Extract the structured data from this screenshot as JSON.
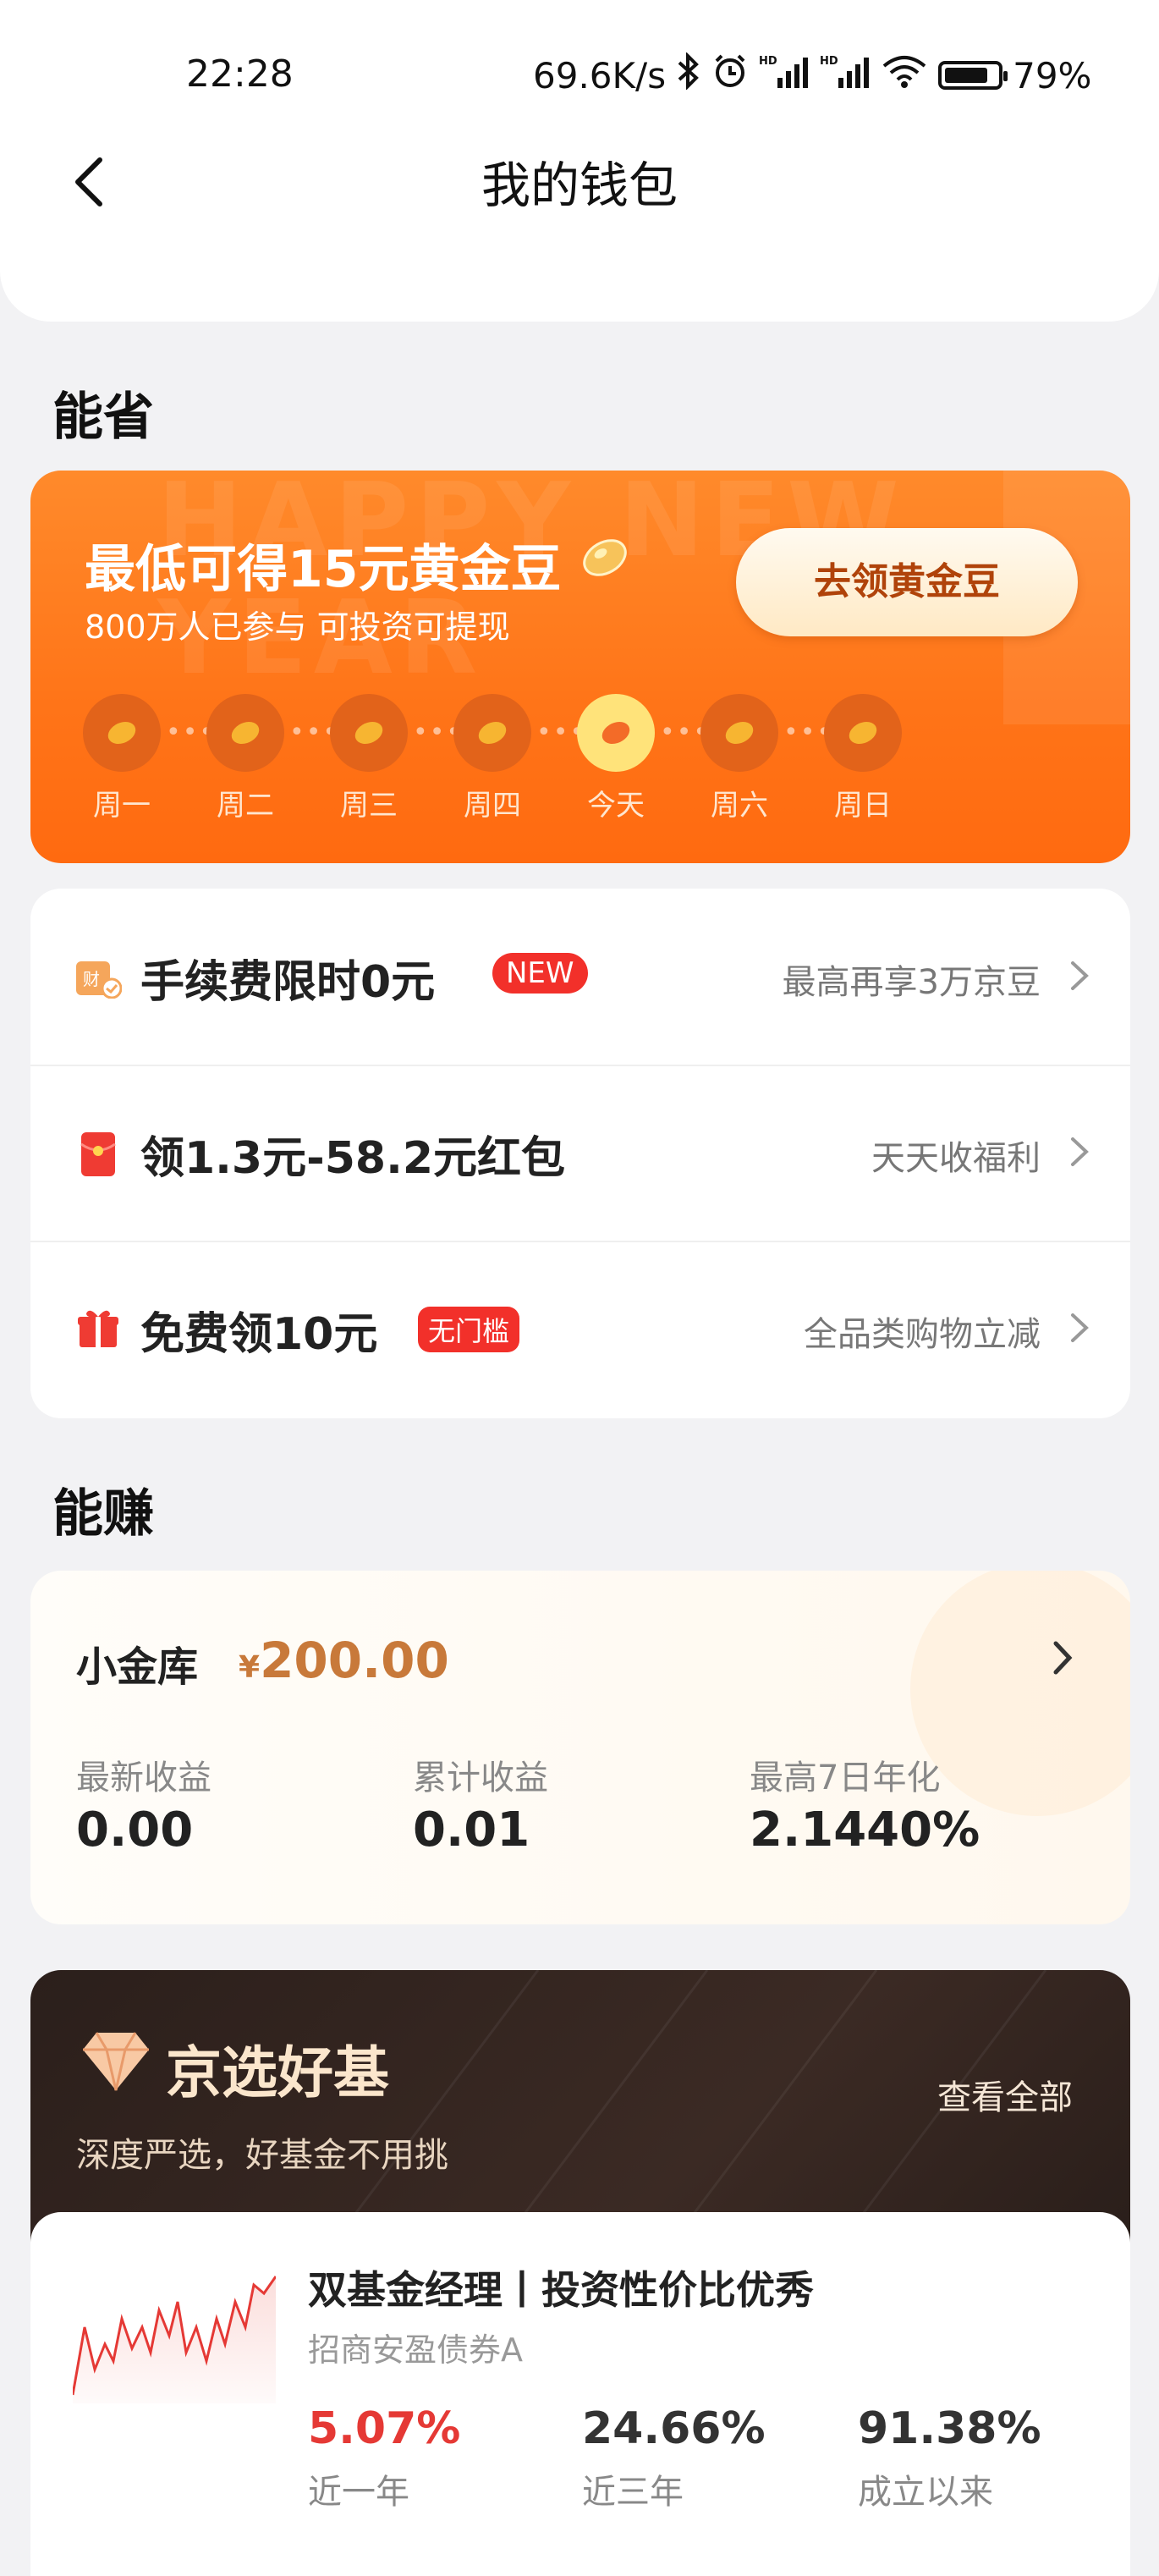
{
  "status_bar": {
    "time": "22:28",
    "network_speed": "69.6K/s",
    "battery": "79%"
  },
  "header": {
    "title": "我的钱包",
    "cut_off_items": [
      "",
      "",
      "",
      ""
    ]
  },
  "save_section": {
    "title": "能省",
    "gold_card": {
      "title": "最低可得15元黄金豆",
      "subtitle": "800万人已参与 可投资可提现",
      "button": "去领黄金豆",
      "days": [
        "周一",
        "周二",
        "周三",
        "周四",
        "今天",
        "周六",
        "周日"
      ]
    },
    "offers": [
      {
        "title": "手续费限时0元",
        "badge": "NEW",
        "right": "最高再享3万京豆",
        "icon": "fee-icon"
      },
      {
        "title": "领1.3元-58.2元红包",
        "badge": "",
        "right": "天天收福利",
        "icon": "red-packet-icon"
      },
      {
        "title": "免费领10元",
        "badge": "无门槛",
        "right": "全品类购物立减",
        "icon": "gift-icon"
      }
    ]
  },
  "earn_section": {
    "title": "能赚",
    "vault": {
      "title": "小金库",
      "currency": "¥",
      "amount": "200.00",
      "stats": [
        {
          "label": "最新收益",
          "value": "0.00"
        },
        {
          "label": "累计收益",
          "value": "0.01"
        },
        {
          "label": "最高7日年化",
          "value": "2.1440%"
        }
      ]
    }
  },
  "fund_section": {
    "title": "京选好基",
    "subtitle": "深度严选，好基金不用挑",
    "view_all": "查看全部",
    "fund": {
      "name": "双基金经理丨投资性价比优秀",
      "code": "招商安盈债券A",
      "stats": [
        {
          "value": "5.07%",
          "label": "近一年"
        },
        {
          "value": "24.66%",
          "label": "近三年"
        },
        {
          "value": "91.38%",
          "label": "成立以来"
        }
      ]
    }
  },
  "colors": {
    "orange": "#ff7418",
    "red": "#f2302a",
    "gold_text": "#c8793a",
    "dark_brown": "#2b1f1b"
  }
}
